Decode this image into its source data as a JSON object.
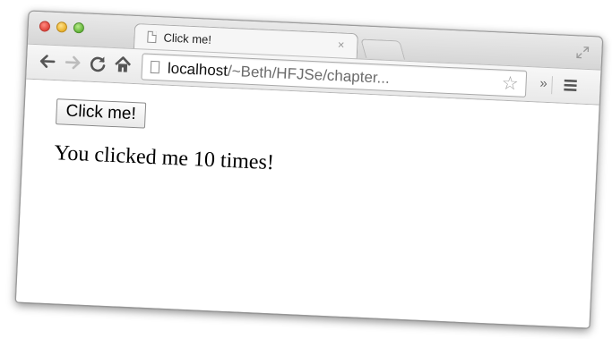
{
  "browser": {
    "tab": {
      "title": "Click me!",
      "close_glyph": "×"
    },
    "toolbar": {
      "back_icon": "back-arrow-icon",
      "forward_icon": "forward-arrow-icon",
      "reload_icon": "reload-icon",
      "home_icon": "home-icon",
      "more_label": "»",
      "menu_icon": "hamburger-menu-icon"
    },
    "address_bar": {
      "url_host": "localhost",
      "url_path": "/~Beth/HFJSe/chapter...",
      "bookmark_icon": "star-icon"
    }
  },
  "page": {
    "button_label": "Click me!",
    "message": "You clicked me 10 times!"
  },
  "colors": {
    "close_red": "#e0443b",
    "minimize_yellow": "#e9b02a",
    "zoom_green": "#63b43a"
  }
}
